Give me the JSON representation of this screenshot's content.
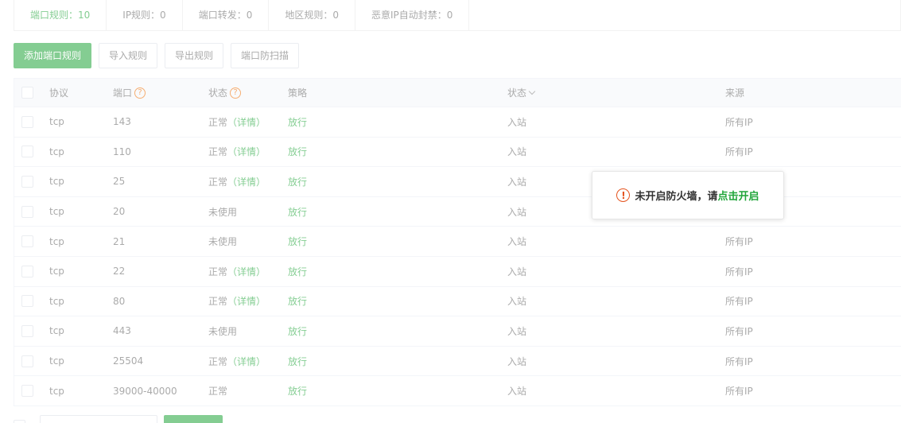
{
  "tabs": [
    {
      "label": "端口规则：10",
      "active": true
    },
    {
      "label": "IP规则：0",
      "active": false
    },
    {
      "label": "端口转发：0",
      "active": false
    },
    {
      "label": "地区规则：0",
      "active": false
    },
    {
      "label": "恶意IP自动封禁：0",
      "active": false
    }
  ],
  "toolbar": {
    "add_label": "添加端口规则",
    "import_label": "导入规则",
    "export_label": "导出规则",
    "scan_label": "端口防扫描"
  },
  "table": {
    "headers": {
      "protocol": "协议",
      "port": "端口",
      "status": "状态",
      "policy": "策略",
      "direction": "状态",
      "source": "来源"
    },
    "rows": [
      {
        "protocol": "tcp",
        "port": "143",
        "status": "正常",
        "detail": "（详情）",
        "policy": "放行",
        "direction": "入站",
        "source": "所有IP"
      },
      {
        "protocol": "tcp",
        "port": "110",
        "status": "正常",
        "detail": "（详情）",
        "policy": "放行",
        "direction": "入站",
        "source": "所有IP"
      },
      {
        "protocol": "tcp",
        "port": "25",
        "status": "正常",
        "detail": "（详情）",
        "policy": "放行",
        "direction": "入站",
        "source": ""
      },
      {
        "protocol": "tcp",
        "port": "20",
        "status": "未使用",
        "detail": "",
        "policy": "放行",
        "direction": "入站",
        "source": ""
      },
      {
        "protocol": "tcp",
        "port": "21",
        "status": "未使用",
        "detail": "",
        "policy": "放行",
        "direction": "入站",
        "source": "所有IP"
      },
      {
        "protocol": "tcp",
        "port": "22",
        "status": "正常",
        "detail": "（详情）",
        "policy": "放行",
        "direction": "入站",
        "source": "所有IP"
      },
      {
        "protocol": "tcp",
        "port": "80",
        "status": "正常",
        "detail": "（详情）",
        "policy": "放行",
        "direction": "入站",
        "source": "所有IP"
      },
      {
        "protocol": "tcp",
        "port": "443",
        "status": "未使用",
        "detail": "",
        "policy": "放行",
        "direction": "入站",
        "source": "所有IP"
      },
      {
        "protocol": "tcp",
        "port": "25504",
        "status": "正常",
        "detail": "（详情）",
        "policy": "放行",
        "direction": "入站",
        "source": "所有IP"
      },
      {
        "protocol": "tcp",
        "port": "39000-40000",
        "status": "正常",
        "detail": "",
        "policy": "放行",
        "direction": "入站",
        "source": "所有IP"
      }
    ]
  },
  "notice": {
    "text": "未开启防火墙，请",
    "link": "点击开启",
    "icon": "warning-circle-icon"
  },
  "colors": {
    "accent": "#20a53a",
    "warning": "#e5541f"
  }
}
